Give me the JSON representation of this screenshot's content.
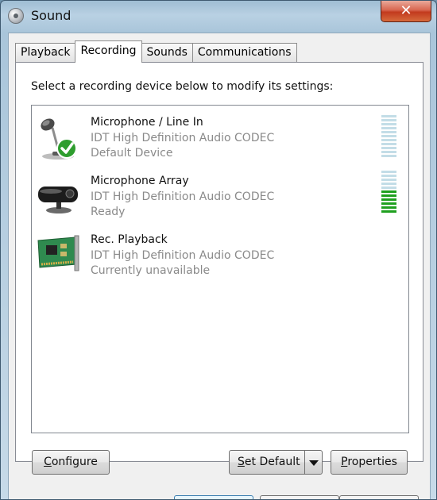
{
  "window": {
    "title": "Sound",
    "close_label": "✕"
  },
  "tabs": [
    {
      "label": "Playback",
      "active": false
    },
    {
      "label": "Recording",
      "active": true
    },
    {
      "label": "Sounds",
      "active": false
    },
    {
      "label": "Communications",
      "active": false
    }
  ],
  "panel": {
    "instruction": "Select a recording device below to modify its settings:"
  },
  "devices": [
    {
      "name": "Microphone / Line In",
      "description": "IDT High Definition Audio CODEC",
      "status": "Default Device",
      "icon": "microphone-icon",
      "default": true,
      "level_segments_on": 0
    },
    {
      "name": "Microphone Array",
      "description": "IDT High Definition Audio CODEC",
      "status": "Ready",
      "icon": "webcam-icon",
      "default": false,
      "level_segments_on": 6
    },
    {
      "name": "Rec. Playback",
      "description": "IDT High Definition Audio CODEC",
      "status": "Currently unavailable",
      "icon": "sound-card-icon",
      "default": false,
      "level_segments_on": null
    }
  ],
  "level_meter_total_segments": 11,
  "buttons": {
    "configure_mnemonic": "C",
    "configure_rest": "onfigure",
    "set_default_mnemonic": "S",
    "set_default_rest": "et Default",
    "properties_mnemonic": "P",
    "properties_rest": "roperties"
  },
  "colors": {
    "meter_on": "#1fa01f",
    "meter_off": "#c3dde7",
    "check_green": "#2e9d2e"
  }
}
